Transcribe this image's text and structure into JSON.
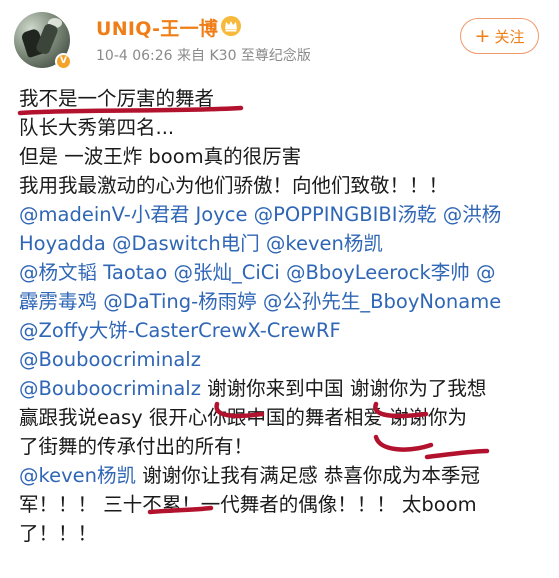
{
  "header": {
    "username": "UNIQ-王一博",
    "timestamp": "10-4 06:26",
    "source": "来自 K30 至尊纪念版",
    "follow_label": "关注",
    "follow_icon": "plus-icon",
    "vip_icon": "crown-icon",
    "verified_badge": "v-badge-icon"
  },
  "post": {
    "lines": [
      [
        {
          "t": "txt",
          "v": "我不是一个厉害的舞者"
        }
      ],
      [
        {
          "t": "txt",
          "v": "队长大秀第四名..."
        }
      ],
      [
        {
          "t": "txt",
          "v": "但是 一波王炸 boom真的很厉害"
        }
      ],
      [
        {
          "t": "txt",
          "v": "我用我最激动的心为他们骄傲！向他们致敬！！！"
        }
      ],
      [
        {
          "t": "mention",
          "v": "@madeinV-小君君 Joyce"
        },
        {
          "t": "txt",
          "v": " "
        },
        {
          "t": "mention",
          "v": "@POPPINGBIBI汤乾"
        },
        {
          "t": "txt",
          "v": " "
        },
        {
          "t": "mention",
          "v": "@洪杨"
        }
      ],
      [
        {
          "t": "mention",
          "v": "Hoyadda"
        },
        {
          "t": "txt",
          "v": " "
        },
        {
          "t": "mention",
          "v": "@Daswitch电门"
        },
        {
          "t": "txt",
          "v": " "
        },
        {
          "t": "mention",
          "v": "@keven杨凯"
        }
      ],
      [
        {
          "t": "mention",
          "v": "@杨文韬 Taotao"
        },
        {
          "t": "txt",
          "v": " "
        },
        {
          "t": "mention",
          "v": "@张灿_CiCi"
        },
        {
          "t": "txt",
          "v": " "
        },
        {
          "t": "mention",
          "v": "@BboyLeerock李帅"
        },
        {
          "t": "txt",
          "v": " "
        },
        {
          "t": "mention",
          "v": "@"
        }
      ],
      [
        {
          "t": "mention",
          "v": "霹雳毒鸡"
        },
        {
          "t": "txt",
          "v": " "
        },
        {
          "t": "mention",
          "v": "@DaTing-杨雨婷"
        },
        {
          "t": "txt",
          "v": " "
        },
        {
          "t": "mention",
          "v": "@公孙先生_BboyNoname"
        }
      ],
      [
        {
          "t": "mention",
          "v": "@Zoffy大饼-CasterCrewX-CrewRF"
        }
      ],
      [
        {
          "t": "mention",
          "v": "@Bouboocriminalz"
        }
      ],
      [
        {
          "t": "txt",
          "v": " "
        },
        {
          "t": "mention",
          "v": "@Bouboocriminalz"
        },
        {
          "t": "txt",
          "v": " 谢谢你来到中国 谢谢你为了我想"
        }
      ],
      [
        {
          "t": "txt",
          "v": "赢跟我说easy 很开心你跟中国的舞者相爱 谢谢你为"
        }
      ],
      [
        {
          "t": "txt",
          "v": "了街舞的传承付出的所有！"
        }
      ],
      [
        {
          "t": "mention",
          "v": "@keven杨凯"
        },
        {
          "t": "txt",
          "v": " 谢谢你让我有满足感 恭喜你成为本季冠"
        }
      ],
      [
        {
          "t": "txt",
          "v": "军！！！ 三十不累！一代舞者的偶像！！！ 太boom"
        }
      ],
      [
        {
          "t": "txt",
          "v": "了！！！"
        }
      ]
    ]
  },
  "watermark": "",
  "colors": {
    "username": "#f07e16",
    "mention": "#2f66b5",
    "underline": "#b3122e",
    "meta": "#8a8a8a"
  }
}
